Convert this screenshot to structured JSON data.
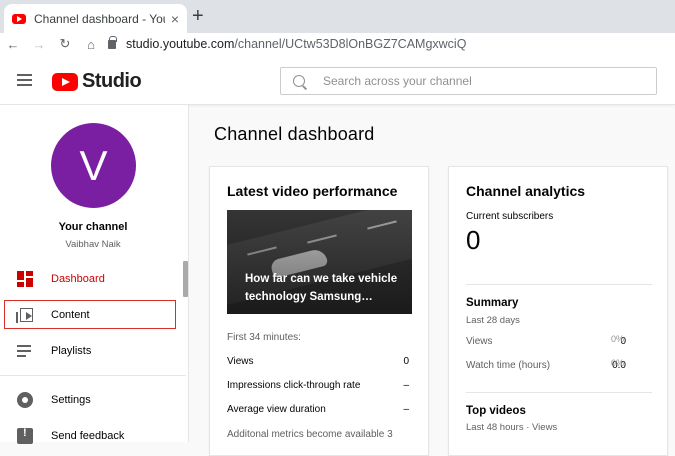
{
  "browser": {
    "tab_title": "Channel dashboard - YouTube Studio",
    "tab_close": "×",
    "new_tab": "+",
    "url_host": "studio.youtube.com",
    "url_path": "/channel/UCtw53D8lOnBGZ7CAMgxwciQ",
    "nav_icons": [
      "back-arrow",
      "forward-arrow",
      "reload",
      "home"
    ]
  },
  "header": {
    "logo_text": "Studio",
    "search_placeholder": "Search across your channel"
  },
  "sidebar": {
    "avatar_letter": "V",
    "your_channel": "Your channel",
    "channel_name": "Vaibhav Naik",
    "items": [
      {
        "label": "Dashboard",
        "icon": "dashboard-icon"
      },
      {
        "label": "Content",
        "icon": "content-icon"
      },
      {
        "label": "Playlists",
        "icon": "playlists-icon"
      },
      {
        "label": "Settings",
        "icon": "settings-icon"
      },
      {
        "label": "Send feedback",
        "icon": "feedback-icon"
      }
    ]
  },
  "main": {
    "page_title": "Channel dashboard",
    "latest": {
      "title": "Latest video performance",
      "video_title": "How far can we take vehicle technology Samsung…",
      "first_minutes": "First 34 minutes:",
      "metrics": [
        {
          "label": "Views",
          "value": "0"
        },
        {
          "label": "Impressions click-through rate",
          "value": "–"
        },
        {
          "label": "Average view duration",
          "value": "–"
        }
      ],
      "note": "Additonal metrics become available 3"
    },
    "analytics": {
      "title": "Channel analytics",
      "subscribers_label": "Current subscribers",
      "subscribers_value": "0",
      "summary_title": "Summary",
      "summary_sub": "Last 28 days",
      "rows": [
        {
          "label": "Views",
          "value": "0",
          "pct": "0%"
        },
        {
          "label": "Watch time (hours)",
          "value": "0.0",
          "pct": "0%"
        }
      ],
      "top_title": "Top videos",
      "top_sub": "Last 48 hours · Views"
    }
  },
  "colors": {
    "accent": "#cc0000",
    "avatar": "#7b1fa2",
    "highlight_box": "#d93025"
  }
}
